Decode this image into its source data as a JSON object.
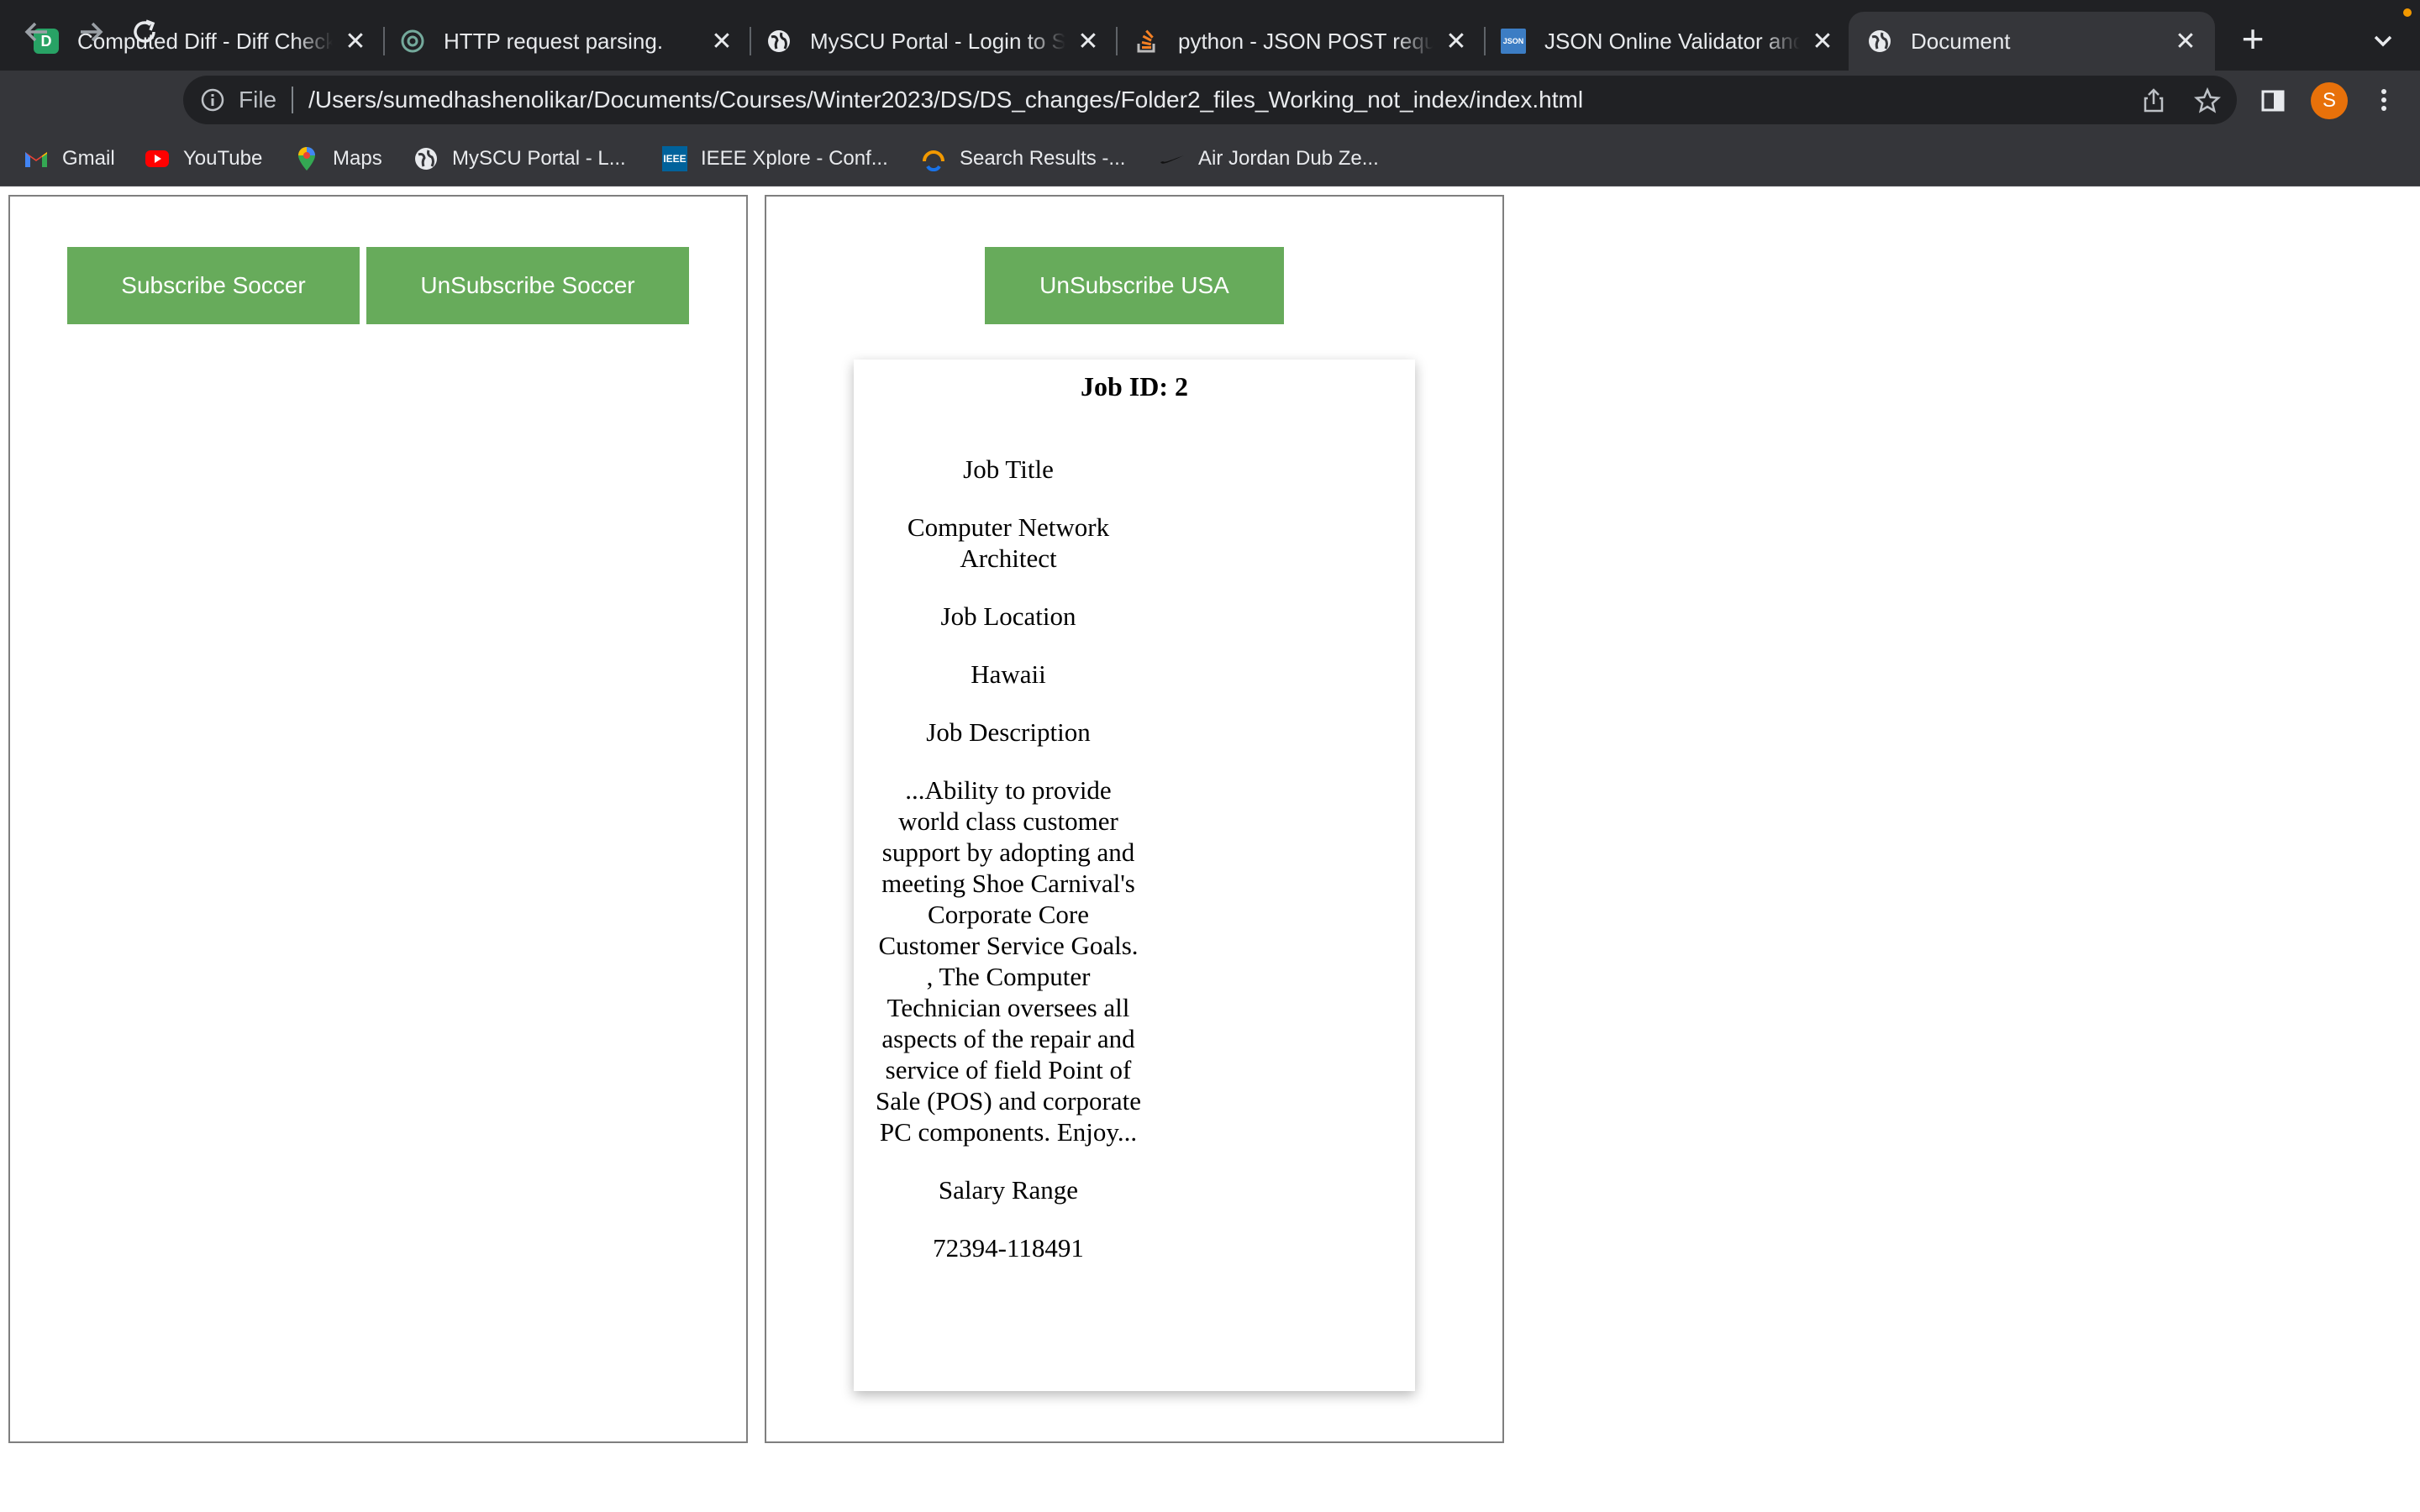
{
  "tabs": [
    {
      "title": "Computed Diff - Diff Checker",
      "icon": "diffchecker-icon",
      "icon_color": "#28a265"
    },
    {
      "title": "HTTP request parsing.",
      "icon": "chatgpt-icon",
      "icon_color": "#74aa9c"
    },
    {
      "title": "MySCU Portal - Login to Santa Clara",
      "icon": "globe-icon",
      "icon_color": "#e8eaed"
    },
    {
      "title": "python - JSON POST request",
      "icon": "stackoverflow-icon",
      "icon_color": "#f48024"
    },
    {
      "title": "JSON Online Validator and Formatter",
      "icon": "json-icon",
      "icon_color": "#3c7dc4"
    },
    {
      "title": "Document",
      "icon": "globe-icon",
      "icon_color": "#e8eaed",
      "active": true
    }
  ],
  "omnibox": {
    "scheme": "File",
    "url": "/Users/sumedhashenolikar/Documents/Courses/Winter2023/DS/DS_changes/Folder2_files_Working_not_index/index.html"
  },
  "profile_initial": "S",
  "bookmarks": [
    {
      "label": "Gmail",
      "icon": "gmail-icon"
    },
    {
      "label": "YouTube",
      "icon": "youtube-icon"
    },
    {
      "label": "Maps",
      "icon": "maps-icon"
    },
    {
      "label": "MySCU Portal - L...",
      "icon": "globe-icon"
    },
    {
      "label": "IEEE Xplore - Conf...",
      "icon": "ieee-icon"
    },
    {
      "label": "Search Results -...",
      "icon": "search-results-icon"
    },
    {
      "label": "Air Jordan Dub Ze...",
      "icon": "nike-icon"
    }
  ],
  "left_panel": {
    "subscribe_label": "Subscribe Soccer",
    "unsubscribe_label": "UnSubscribe Soccer"
  },
  "right_panel": {
    "unsubscribe_label": "UnSubscribe USA"
  },
  "job_card": {
    "title": "Job ID: 2",
    "title_label": "Job Title",
    "title_value": "Computer Network Architect",
    "location_label": "Job Location",
    "location_value": "Hawaii",
    "description_label": "Job Description",
    "description_value": "...Ability to provide world class customer support by adopting and meeting Shoe Carnival's Corporate Core Customer Service Goals. , The Computer Technician oversees all aspects of the repair and service of field Point of Sale (POS) and corporate PC components. Enjoy...",
    "salary_label": "Salary Range",
    "salary_value": "72394-118491"
  },
  "colors": {
    "button_green": "#67ab5b",
    "chrome_dark": "#202124",
    "chrome_toolbar": "#35363a",
    "avatar_orange": "#e8710a"
  }
}
